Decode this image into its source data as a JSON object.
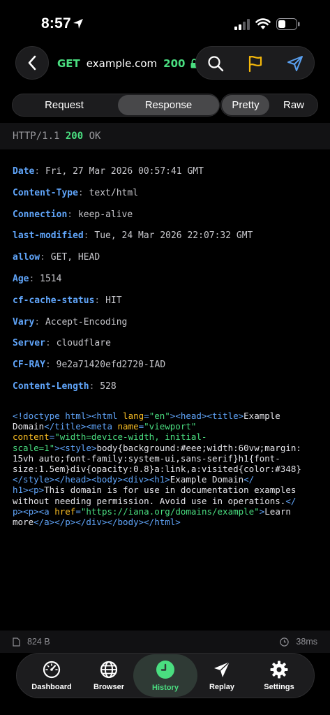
{
  "status_bar": {
    "time": "8:57"
  },
  "nav": {
    "method": "GET",
    "host": "example.com",
    "status_code": "200"
  },
  "segments": {
    "request": "Request",
    "response": "Response",
    "pretty": "Pretty",
    "raw": "Raw"
  },
  "status_line": {
    "protocol": "HTTP/1.1",
    "code": "200",
    "text": "OK"
  },
  "headers": [
    {
      "name": "Date",
      "value": "Fri, 27 Mar 2026 00:57:41 GMT"
    },
    {
      "name": "Content-Type",
      "value": "text/html"
    },
    {
      "name": "Connection",
      "value": "keep-alive"
    },
    {
      "name": "last-modified",
      "value": "Tue, 24 Mar 2026 22:07:32 GMT"
    },
    {
      "name": "allow",
      "value": "GET, HEAD"
    },
    {
      "name": "Age",
      "value": "1514"
    },
    {
      "name": "cf-cache-status",
      "value": "HIT"
    },
    {
      "name": "Vary",
      "value": "Accept-Encoding"
    },
    {
      "name": "Server",
      "value": "cloudflare"
    },
    {
      "name": "CF-RAY",
      "value": "9e2a71420efd2720-IAD"
    },
    {
      "name": "Content-Length",
      "value": "528"
    }
  ],
  "body_lines": [
    [
      [
        "tag",
        "<!doctype html>"
      ],
      [
        "tag",
        "<html "
      ],
      [
        "attr",
        "lang"
      ],
      [
        "tag",
        "="
      ],
      [
        "str",
        "\"en\""
      ],
      [
        "tag",
        "><head><title>"
      ],
      [
        "txt",
        "Example"
      ]
    ],
    [
      [
        "txt",
        "Domain"
      ],
      [
        "tag",
        "</title><meta "
      ],
      [
        "attr",
        "name"
      ],
      [
        "tag",
        "="
      ],
      [
        "str",
        "\"viewport\""
      ]
    ],
    [
      [
        "attr",
        "content"
      ],
      [
        "tag",
        "="
      ],
      [
        "str",
        "\"width=device-width, initial-"
      ]
    ],
    [
      [
        "str",
        "scale=1\""
      ],
      [
        "tag",
        "><style>"
      ],
      [
        "txt",
        "body{background:#eee;width:60vw;margin:"
      ]
    ],
    [
      [
        "txt",
        "15vh auto;font-family:system-ui,sans-serif}h1{font-"
      ]
    ],
    [
      [
        "txt",
        "size:1.5em}div{opacity:0.8}a:link,a:visited{color:#348}"
      ]
    ],
    [
      [
        "tag",
        "</style></head><body><div><h1>"
      ],
      [
        "txt",
        "Example Domain"
      ],
      [
        "tag",
        "</"
      ]
    ],
    [
      [
        "tag",
        "h1><p>"
      ],
      [
        "txt",
        "This domain is for use in documentation examples"
      ]
    ],
    [
      [
        "txt",
        "without needing permission. Avoid use in operations."
      ],
      [
        "tag",
        "</"
      ]
    ],
    [
      [
        "tag",
        "p><p><a "
      ],
      [
        "attr",
        "href"
      ],
      [
        "tag",
        "="
      ],
      [
        "str",
        "\"https://iana.org/domains/example\""
      ],
      [
        "tag",
        ">"
      ],
      [
        "txt",
        "Learn"
      ]
    ],
    [
      [
        "txt",
        "more"
      ],
      [
        "tag",
        "</a></p></div></body></html>"
      ]
    ]
  ],
  "footer": {
    "size": "824 B",
    "duration": "38ms"
  },
  "tabs": [
    {
      "id": "dashboard",
      "label": "Dashboard",
      "icon": "gauge-icon"
    },
    {
      "id": "browser",
      "label": "Browser",
      "icon": "globe-icon"
    },
    {
      "id": "history",
      "label": "History",
      "icon": "clock-icon",
      "active": true
    },
    {
      "id": "replay",
      "label": "Replay",
      "icon": "paper-plane-icon"
    },
    {
      "id": "settings",
      "label": "Settings",
      "icon": "gear-icon"
    }
  ],
  "colors": {
    "accent_green": "#4ade80",
    "header_blue": "#60a5fa",
    "attr_yellow": "#fbbf24",
    "flag_yellow": "#f5b80b",
    "send_blue": "#5aa0f0"
  }
}
